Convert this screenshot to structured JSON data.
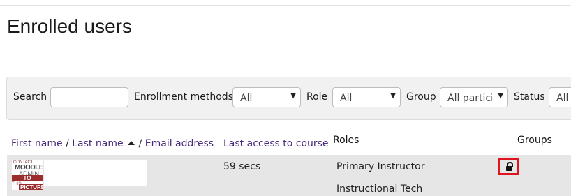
{
  "page": {
    "title": "Enrolled users"
  },
  "filters": {
    "search_label": "Search",
    "search_value": "",
    "enrollment_label": "Enrollment methods",
    "enrollment_value": "All",
    "role_label": "Role",
    "role_value": "All",
    "group_label": "Group",
    "group_value": "All partici",
    "status_label": "Status",
    "status_value": "All"
  },
  "columns": {
    "first_name": "First name",
    "last_name": "Last name",
    "email": "Email address",
    "last_access": "Last access to course",
    "roles": "Roles",
    "groups": "Groups",
    "sep": "/"
  },
  "rows": [
    {
      "avatar_text": [
        "CONTACT",
        "MOODLE",
        "ADMIN",
        "TO UPDATE",
        "THIS",
        "PICTURE"
      ],
      "last_access": "59 secs",
      "roles": [
        "Primary Instructor",
        "Instructional Tech"
      ],
      "group_icon": "lock-icon"
    }
  ],
  "colors": {
    "link": "#4a2a7d",
    "highlight": "#e0141e",
    "row_bg": "#e6e6e6"
  }
}
